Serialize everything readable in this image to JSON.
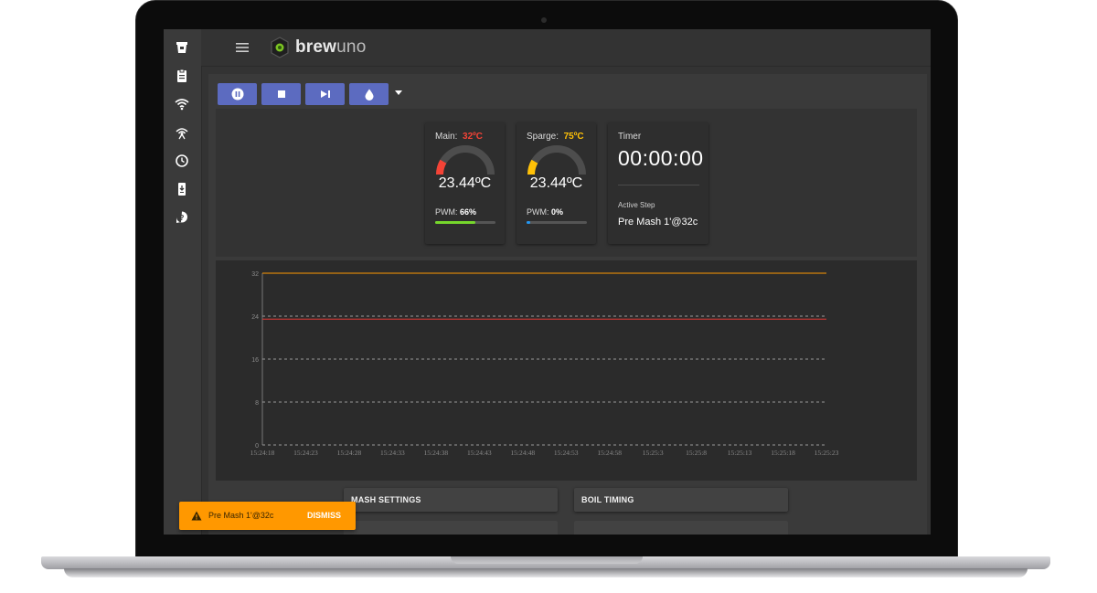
{
  "app": {
    "logo_main": "brew",
    "logo_accent": "uno"
  },
  "sidebar": {
    "items": [
      {
        "icon": "recipes-icon"
      },
      {
        "icon": "clipboard-icon"
      },
      {
        "icon": "wifi-icon"
      },
      {
        "icon": "broadcast-icon"
      },
      {
        "icon": "clock-icon"
      },
      {
        "icon": "firmware-icon"
      },
      {
        "icon": "help-icon"
      }
    ]
  },
  "toolbar": {
    "buttons": [
      "pause-icon",
      "stop-icon",
      "skip-next-icon",
      "water-drop-icon"
    ],
    "accent": "#5c6bc0"
  },
  "main_kettle": {
    "label": "Main:",
    "target": "32ºC",
    "target_color": "#f44336",
    "temp": "23.44ºC",
    "pwm_label": "PWM:",
    "pwm": "66%",
    "pwm_fraction": 0.66,
    "pwm_color": "#76d72c",
    "gauge_fraction": 0.17
  },
  "sparge_kettle": {
    "label": "Sparge:",
    "target": "75ºC",
    "target_color": "#ffc107",
    "temp": "23.44ºC",
    "pwm_label": "PWM:",
    "pwm": "0%",
    "pwm_fraction": 0.0,
    "pwm_color": "#2196f3",
    "gauge_fraction": 0.17
  },
  "timer": {
    "label": "Timer",
    "value": "00:00:00",
    "active_step_label": "Active Step",
    "active_step": "Pre Mash 1'@32c"
  },
  "chart_data": {
    "type": "line",
    "x": [
      "15:24:18",
      "15:24:23",
      "15:24:28",
      "15:24:33",
      "15:24:38",
      "15:24:43",
      "15:24:48",
      "15:24:53",
      "15:24:58",
      "15:25:3",
      "15:25:8",
      "15:25:13",
      "15:25:18",
      "15:25:23"
    ],
    "yticks": [
      0,
      8,
      16,
      24,
      32
    ],
    "ylim": [
      0,
      32
    ],
    "grid": true,
    "series": [
      {
        "values": [
          32,
          32,
          32,
          32,
          32,
          32,
          32,
          32,
          32,
          32,
          32,
          32,
          32,
          32
        ],
        "color": "#ff9800"
      },
      {
        "values": [
          23.44,
          23.44,
          23.44,
          23.44,
          23.44,
          23.44,
          23.44,
          23.44,
          23.44,
          23.44,
          23.44,
          23.44,
          23.44,
          23.44
        ],
        "color": "#e53935"
      }
    ]
  },
  "sections": {
    "mash_settings": "MASH SETTINGS",
    "boil_timing": "BOIL TIMING"
  },
  "snackbar": {
    "message": "Pre Mash 1'@32c",
    "action": "DISMISS",
    "color": "#ff9800"
  }
}
